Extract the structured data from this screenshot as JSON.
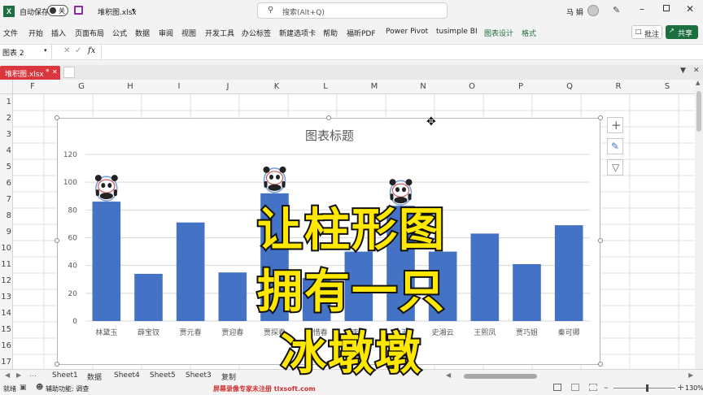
{
  "titlebar": {
    "autosave_label": "自动保存",
    "autosave_state": "关",
    "filename": "堆积图.xlsx",
    "filename_caret": "▾",
    "search_placeholder": "搜索(Alt+Q)",
    "user_name": "马 娟"
  },
  "ribbon": {
    "tabs": [
      "文件",
      "开始",
      "插入",
      "页面布局",
      "公式",
      "数据",
      "审阅",
      "视图",
      "开发工具",
      "办公标签",
      "新建选项卡",
      "帮助",
      "福昕PDF",
      "Power Pivot",
      "tusimple BI",
      "图表设计",
      "格式"
    ],
    "comment_button": "批注",
    "share_button": "共享"
  },
  "formula_bar": {
    "name_box": "图表 2",
    "fx": "fx",
    "formula": ""
  },
  "doc_tab": {
    "label": "堆积图.xlsx",
    "modified_mark": "*"
  },
  "columns": [
    "F",
    "G",
    "H",
    "I",
    "J",
    "K",
    "L",
    "M",
    "N",
    "O",
    "P",
    "Q",
    "R",
    "S"
  ],
  "rows": [
    "1",
    "2",
    "3",
    "4",
    "5",
    "6",
    "7",
    "8",
    "9",
    "10",
    "11",
    "12",
    "13",
    "14",
    "15",
    "16",
    "17"
  ],
  "chart_data": {
    "type": "bar",
    "title": "图表标题",
    "categories": [
      "林黛玉",
      "薛宝钗",
      "贾元春",
      "贾迎春",
      "贾探春",
      "贾惜春",
      "李纨",
      "妙玉",
      "史湘云",
      "王熙凤",
      "贾巧姐",
      "秦可卿"
    ],
    "values": [
      86,
      34,
      71,
      35,
      92,
      31,
      50,
      83,
      50,
      63,
      41,
      69
    ],
    "yticks": [
      0,
      20,
      40,
      60,
      80,
      100,
      120
    ],
    "ylim": [
      0,
      120
    ],
    "grid": true,
    "series_color": "#4472c4",
    "panda_on": [
      "林黛玉",
      "贾探春",
      "妙玉"
    ]
  },
  "overlay": {
    "lines": [
      "让柱形图",
      "拥有一只",
      "冰墩墩"
    ],
    "color": "#ffe800"
  },
  "sheets": [
    "Sheet1",
    "数据",
    "Sheet4",
    "Sheet5",
    "Sheet3",
    "复制"
  ],
  "status": {
    "ready": "就绪",
    "accessibility": "辅助功能: 调查",
    "watermark": "屏幕录像专家未注册 tlxsoft.com",
    "zoom": "130%"
  }
}
